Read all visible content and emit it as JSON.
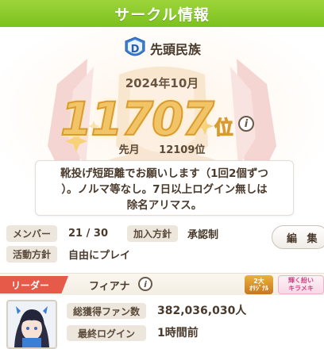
{
  "title": "サークル情報",
  "club": {
    "name": "先頭民族",
    "badge_letter": "D"
  },
  "ranking": {
    "month": "2024年10月",
    "rank": "11707",
    "rank_suffix": "位",
    "last_month_label": "先月",
    "last_month_rank": "12109位"
  },
  "description": [
    "靴投げ短距離でお願いします（1回2個ずつ",
    "）。ノルマ等なし。7日以上ログイン無しは",
    "除名アリマス。"
  ],
  "members": {
    "label": "メンバー",
    "value": "21 / 30"
  },
  "join_policy": {
    "label": "加入方針",
    "value": "承認制"
  },
  "activity_policy": {
    "label": "活動方針",
    "value": "自由にプレイ"
  },
  "edit_button": "編 集",
  "leader": {
    "tag": "リーダー",
    "name": "フィアナ",
    "fans_label": "総獲得ファン数",
    "fans_value": "382,036,030人",
    "login_label": "最終ログイン",
    "login_value": "1時間前"
  },
  "badges": {
    "rank": "2大",
    "rank_sub": "ｵﾘｼﾞﾅﾙ",
    "sparkle_top": "輝く紛い",
    "sparkle_bottom": "キラメキ"
  },
  "colors": {
    "title_bar": "#86c826",
    "rank_gold": "#f2c468",
    "leader_tag": "#e65a4a"
  }
}
